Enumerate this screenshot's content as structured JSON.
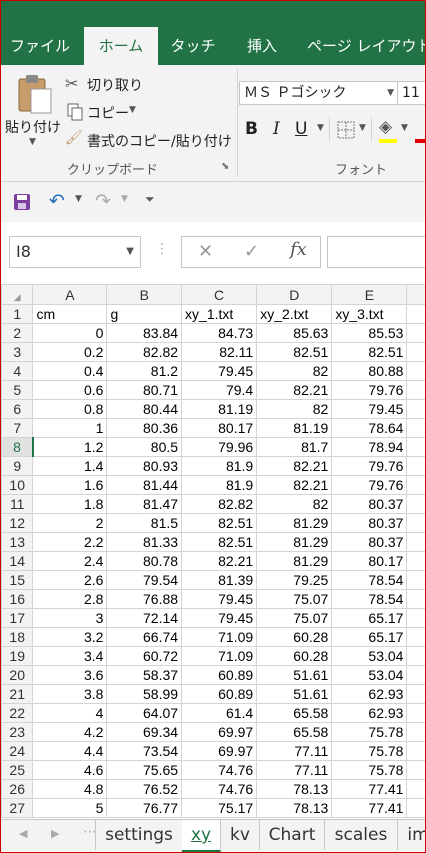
{
  "ribbon_tabs": [
    "ファイル",
    "ホーム",
    "タッチ",
    "挿入",
    "ページ レイアウト"
  ],
  "clipboard": {
    "paste_label": "貼り付け",
    "cut_label": "切り取り",
    "copy_label": "コピー",
    "format_painter_label": "書式のコピー/貼り付け",
    "group_label": "クリップボード"
  },
  "font": {
    "font_name": "ＭＳ Ｐゴシック",
    "font_size": "11",
    "bold": "B",
    "italic": "I",
    "underline": "U",
    "group_label": "フォント"
  },
  "formula_bar": {
    "name_box": "I8",
    "fx": "fx",
    "value": ""
  },
  "columns": [
    "A",
    "B",
    "C",
    "D",
    "E"
  ],
  "header_row": [
    "cm",
    "g",
    "xy_1.txt",
    "xy_2.txt",
    "xy_3.txt"
  ],
  "rows": [
    [
      "0",
      "83.84",
      "84.73",
      "85.63",
      "85.53"
    ],
    [
      "0.2",
      "82.82",
      "82.11",
      "82.51",
      "82.51"
    ],
    [
      "0.4",
      "81.2",
      "79.45",
      "82",
      "80.88"
    ],
    [
      "0.6",
      "80.71",
      "79.4",
      "82.21",
      "79.76"
    ],
    [
      "0.8",
      "80.44",
      "81.19",
      "82",
      "79.45"
    ],
    [
      "1",
      "80.36",
      "80.17",
      "81.19",
      "78.64"
    ],
    [
      "1.2",
      "80.5",
      "79.96",
      "81.7",
      "78.94"
    ],
    [
      "1.4",
      "80.93",
      "81.9",
      "82.21",
      "79.76"
    ],
    [
      "1.6",
      "81.44",
      "81.9",
      "82.21",
      "79.76"
    ],
    [
      "1.8",
      "81.47",
      "82.82",
      "82",
      "80.37"
    ],
    [
      "2",
      "81.5",
      "82.51",
      "81.29",
      "80.37"
    ],
    [
      "2.2",
      "81.33",
      "82.51",
      "81.29",
      "80.37"
    ],
    [
      "2.4",
      "80.78",
      "82.21",
      "81.29",
      "80.17"
    ],
    [
      "2.6",
      "79.54",
      "81.39",
      "79.25",
      "78.54"
    ],
    [
      "2.8",
      "76.88",
      "79.45",
      "75.07",
      "78.54"
    ],
    [
      "3",
      "72.14",
      "79.45",
      "75.07",
      "65.17"
    ],
    [
      "3.2",
      "66.74",
      "71.09",
      "60.28",
      "65.17"
    ],
    [
      "3.4",
      "60.72",
      "71.09",
      "60.28",
      "53.04"
    ],
    [
      "3.6",
      "58.37",
      "60.89",
      "51.61",
      "53.04"
    ],
    [
      "3.8",
      "58.99",
      "60.89",
      "51.61",
      "62.93"
    ],
    [
      "4",
      "64.07",
      "61.4",
      "65.58",
      "62.93"
    ],
    [
      "4.2",
      "69.34",
      "69.97",
      "65.58",
      "75.78"
    ],
    [
      "4.4",
      "73.54",
      "69.97",
      "77.11",
      "75.78"
    ],
    [
      "4.6",
      "75.65",
      "74.76",
      "77.11",
      "75.78"
    ],
    [
      "4.8",
      "76.52",
      "74.76",
      "78.13",
      "77.41"
    ],
    [
      "5",
      "76.77",
      "75.17",
      "78.13",
      "77.41"
    ]
  ],
  "selected_row": 8,
  "sheet_tabs": [
    "settings",
    "xy",
    "kv",
    "Chart",
    "scales",
    "im"
  ],
  "active_sheet": "xy",
  "colors": {
    "accent": "#217346",
    "frame": "#d00000"
  }
}
